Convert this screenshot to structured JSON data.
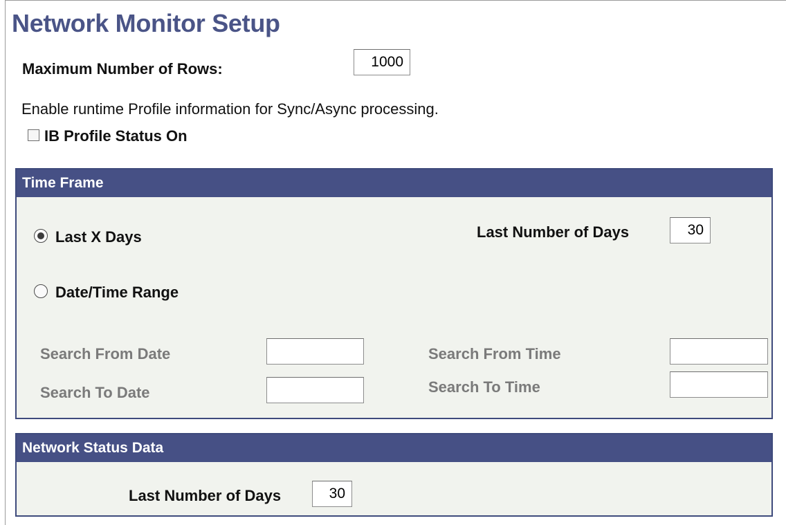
{
  "page": {
    "title": "Network Monitor Setup"
  },
  "max_rows": {
    "label": "Maximum Number of Rows:",
    "value": "1000"
  },
  "profile": {
    "description": "Enable runtime Profile information for Sync/Async processing.",
    "checkbox_label": "IB Profile Status On",
    "checked": false
  },
  "time_frame": {
    "header": "Time Frame",
    "radio_last_x_days": {
      "label": "Last X Days",
      "selected": true
    },
    "radio_date_range": {
      "label": "Date/Time Range",
      "selected": false
    },
    "last_number_of_days": {
      "label": "Last Number of Days",
      "value": "30"
    },
    "search_from_date": {
      "label": "Search From Date",
      "value": ""
    },
    "search_to_date": {
      "label": "Search To Date",
      "value": ""
    },
    "search_from_time": {
      "label": "Search From Time",
      "value": ""
    },
    "search_to_time": {
      "label": "Search To Time",
      "value": ""
    }
  },
  "network_status": {
    "header": "Network Status Data",
    "last_number_of_days": {
      "label": "Last Number of Days",
      "value": "30"
    }
  },
  "colors": {
    "title": "#4a5487",
    "group_header_bg": "#465085",
    "group_body_bg": "#f1f3ee",
    "disabled_label": "#7a7a7a"
  }
}
